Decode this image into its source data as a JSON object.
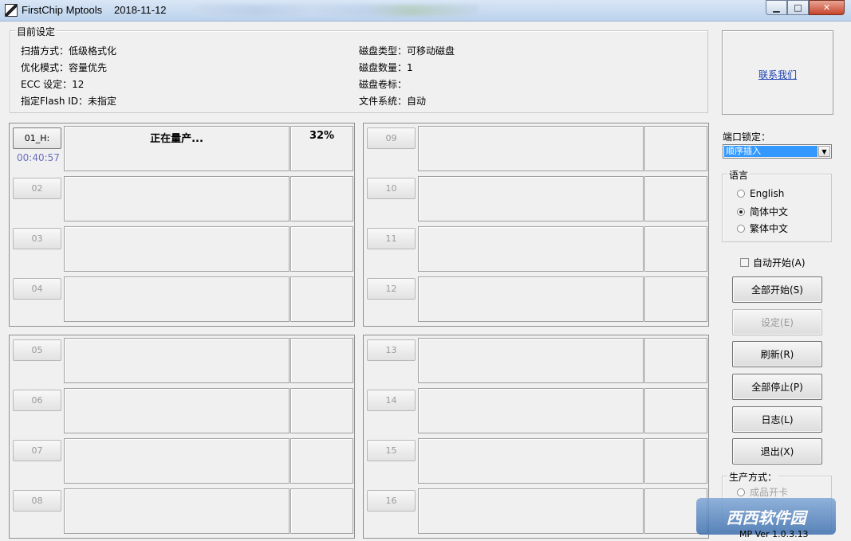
{
  "window": {
    "title": "FirstChip Mptools",
    "date": "2018-11-12",
    "controls": {
      "minimize": "▁",
      "maximize": "□",
      "close": "✕"
    }
  },
  "settings": {
    "legend": "目前设定",
    "left": [
      "扫描方式：低级格式化",
      "优化模式：容量优先",
      "ECC 设定：12",
      "指定Flash ID：未指定"
    ],
    "right": [
      "磁盘类型：可移动磁盘",
      "磁盘数量：1",
      "磁盘卷标：",
      "文件系统：自动"
    ]
  },
  "contact": {
    "link": "联系我们"
  },
  "ports": [
    {
      "label": "01_H:",
      "status": "正在量产...",
      "percent": "32%",
      "timer": "00:40:57",
      "active": true
    },
    {
      "label": "02"
    },
    {
      "label": "03"
    },
    {
      "label": "04"
    },
    {
      "label": "05"
    },
    {
      "label": "06"
    },
    {
      "label": "07"
    },
    {
      "label": "08"
    },
    {
      "label": "09"
    },
    {
      "label": "10"
    },
    {
      "label": "11"
    },
    {
      "label": "12"
    },
    {
      "label": "13"
    },
    {
      "label": "14"
    },
    {
      "label": "15"
    },
    {
      "label": "16"
    }
  ],
  "port_lock": {
    "label": "端口锁定：",
    "value": "顺序插入"
  },
  "language": {
    "legend": "语言",
    "options": [
      "English",
      "简体中文",
      "繁体中文"
    ],
    "selected": "简体中文"
  },
  "auto_start": {
    "label": "自动开始(A)",
    "checked": false
  },
  "buttons": {
    "start_all": "全部开始(S)",
    "settings": "设定(E)",
    "refresh": "刷新(R)",
    "stop_all": "全部停止(P)",
    "log": "日志(L)",
    "exit": "退出(X)"
  },
  "production": {
    "legend": "生产方式：",
    "option1": "成品开卡"
  },
  "version": "MP Ver 1.0.3.13",
  "watermark": "西西软件园"
}
